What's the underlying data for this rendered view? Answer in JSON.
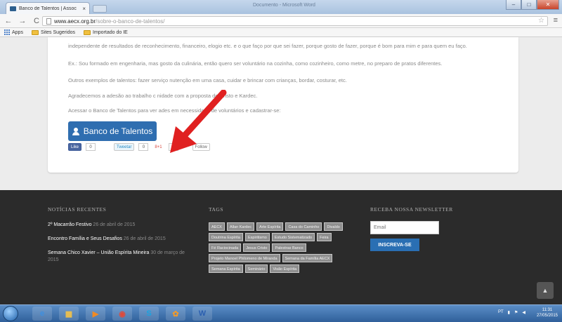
{
  "browser": {
    "tab_title": "Banco de Talentos | Assoc",
    "tab_close": "×",
    "window_title": "Documento - Microsoft Word",
    "url_host": "www.aecx.org.br",
    "url_path": "/sobre-o-banco-de-talentos/",
    "nav_back": "←",
    "nav_forward": "→",
    "nav_reload": "C",
    "bookmarks": [
      {
        "label": "Apps"
      },
      {
        "label": "Sites Sugeridos"
      },
      {
        "label": "Importado do IE"
      }
    ]
  },
  "page": {
    "paragraphs": [
      "independente de resultados de reconhecimento, financeiro, elogio etc. e o que faço por que sei fazer, porque gosto de fazer, porque é bom para mim e para quem eu faço.",
      "Ex.: Sou formado em engenharia, mas gosto da        culinária, então quero ser voluntário na cozinha, como cozinheiro, como metre, no preparo de pratos diferentes.",
      "Outros exemplos de talentos: fazer serviço       nutenção em uma casa, cuidar e brincar com crianças, bordar, costurar, etc.",
      "Agradecemos a adesão ao trabalho c              nidade com a proposta do Cristo e Kardec.",
      "Acessar o Banco de Talentos para ver           ades em necessidade de voluntários e cadastrar-se:"
    ],
    "button_label": "Banco de Talentos",
    "social": {
      "like_label": "Like",
      "like_count": "0",
      "tweet_label": "Tweetar",
      "tweet_count": "0",
      "gplus_label": "8+1",
      "gplus_count": "0",
      "follow_label": "Follow"
    },
    "arrow_color": "#e02020"
  },
  "footer": {
    "recent_heading": "NOTÍCIAS RECENTES",
    "posts": [
      {
        "title": "2º Macarrão Festivo",
        "date": "26 de abril de 2015"
      },
      {
        "title": "Encontro Família e Seus Desafios",
        "date": "26 de abril de 2015"
      },
      {
        "title": "Semana Chico Xavier – União Espírita Mineira",
        "date": "30 de março de 2015"
      }
    ],
    "tags_heading": "TAGS",
    "tags": [
      "AECX",
      "Allan Kardec",
      "Arte Espírita",
      "Casa do Caminho",
      "Divaldo",
      "Doutrina Espírita",
      "Espiritismo",
      "Estudo Sistematizado",
      "Feira",
      "Fé Raciocinada",
      "Jesus Cristo",
      "Palestras Banco",
      "Projeto Manoel Philomeno de Miranda",
      "Semana da Família AECX",
      "Semana Espírita",
      "Seminário",
      "Visão Espírita"
    ],
    "newsletter_heading": "RECEBA NOSSA NEWSLETTER",
    "email_placeholder": "Email",
    "subscribe_label": "INSCREVA-SE",
    "to_top": "▲"
  },
  "taskbar": {
    "apps": [
      {
        "name": "ie",
        "glyph": "e",
        "color": "#3c8fe0"
      },
      {
        "name": "explorer",
        "glyph": "▦",
        "color": "#f2c24a"
      },
      {
        "name": "media",
        "glyph": "▶",
        "color": "#f08a24"
      },
      {
        "name": "chrome",
        "glyph": "◉",
        "color": "#e04a3a"
      },
      {
        "name": "skype",
        "glyph": "S",
        "color": "#1aa3e0"
      },
      {
        "name": "messenger",
        "glyph": "✿",
        "color": "#f09a2a"
      },
      {
        "name": "word",
        "glyph": "W",
        "color": "#2b5fb0"
      }
    ],
    "language": "PT",
    "time": "11:31",
    "date": "27/05/2015"
  }
}
